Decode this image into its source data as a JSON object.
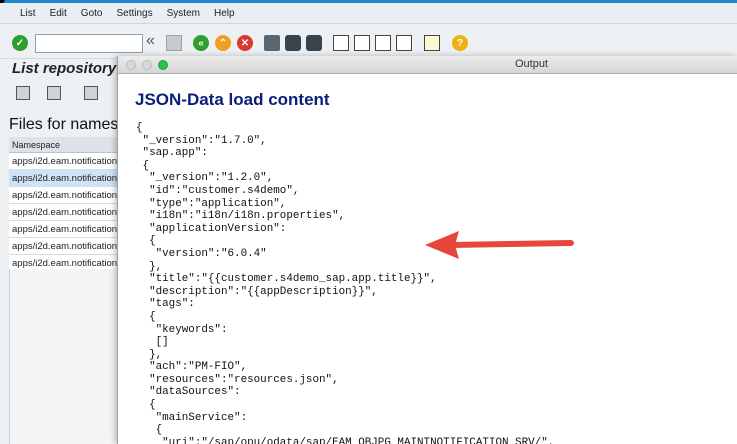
{
  "menu": [
    "List",
    "Edit",
    "Goto",
    "Settings",
    "System",
    "Help"
  ],
  "toolbar": {
    "command_field_value": "",
    "back_double_label": "«"
  },
  "left": {
    "title": "List repository",
    "heading": "Files for names",
    "column_header": "Namespace",
    "rows": [
      "apps/i2d.eam.notification",
      "apps/i2d.eam.notification",
      "apps/i2d.eam.notification",
      "apps/i2d.eam.notification",
      "apps/i2d.eam.notification",
      "apps/i2d.eam.notification",
      "apps/i2d.eam.notification"
    ],
    "selected_index": 1
  },
  "output": {
    "window_title": "Output",
    "heading": "JSON-Data load content",
    "code_lines": [
      "{",
      " \"_version\":\"1.7.0\",",
      " \"sap.app\":",
      " {",
      "  \"_version\":\"1.2.0\",",
      "  \"id\":\"customer.s4demo\",",
      "  \"type\":\"application\",",
      "  \"i18n\":\"i18n/i18n.properties\",",
      "  \"applicationVersion\":",
      "  {",
      "   \"version\":\"6.0.4\"",
      "  },",
      "  \"title\":\"{{customer.s4demo_sap.app.title}}\",",
      "  \"description\":\"{{appDescription}}\",",
      "  \"tags\":",
      "  {",
      "   \"keywords\":",
      "   []",
      "  },",
      "  \"ach\":\"PM-FIO\",",
      "  \"resources\":\"resources.json\",",
      "  \"dataSources\":",
      "  {",
      "   \"mainService\":",
      "   {",
      "    \"uri\":\"/sap/opu/odata/sap/EAM_OBJPG_MAINTNOTIFICATION_SRV/\","
    ]
  },
  "colors": {
    "accent_blue": "#1e88c8",
    "heading_navy": "#0a1f7a",
    "arrow_red": "#e8453c",
    "selection": "#cfe3f6"
  },
  "icons": [
    "check-icon",
    "back-double-icon",
    "save-icon",
    "back-icon",
    "exit-icon",
    "cancel-icon",
    "print-icon",
    "find-icon",
    "find-next-icon",
    "first-page-icon",
    "prev-page-icon",
    "next-page-icon",
    "last-page-icon",
    "bookmark-icon",
    "help-icon"
  ]
}
